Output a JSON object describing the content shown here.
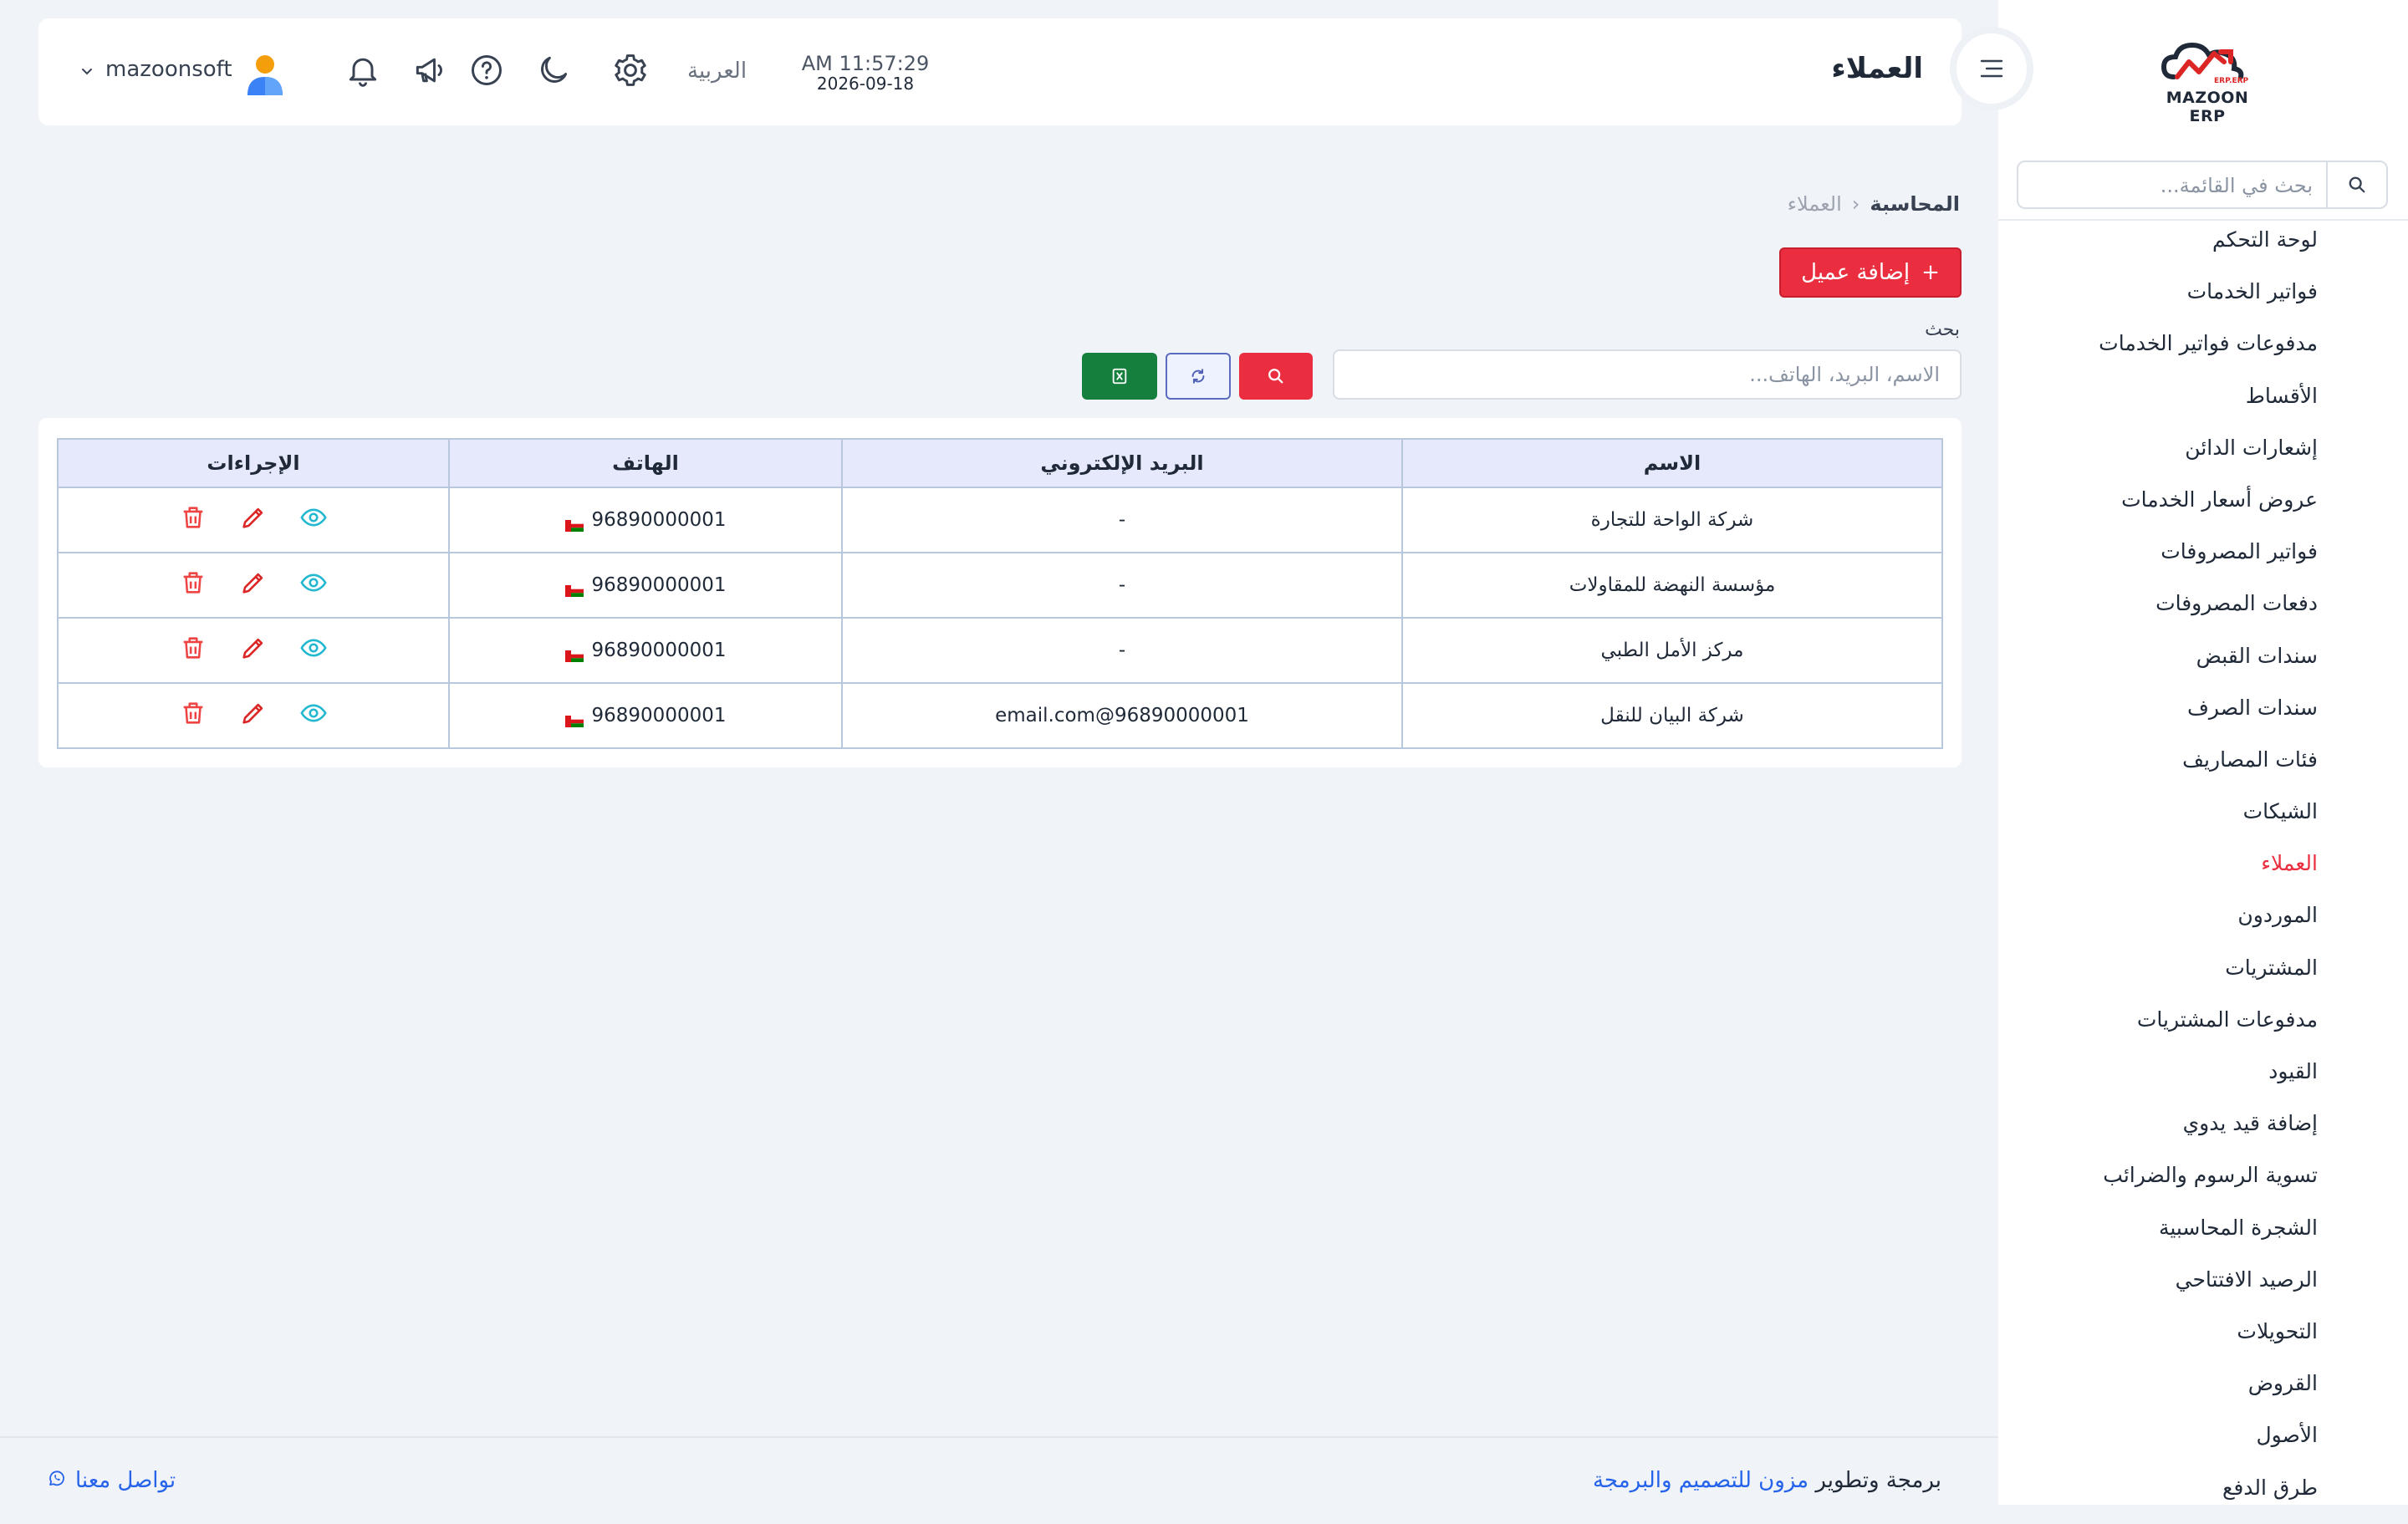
{
  "brand": {
    "logo_text": "MAZOON ERP",
    "logo_sub": "ERP.ERP"
  },
  "sidebar": {
    "search_placeholder": "بحث في القائمة...",
    "items": [
      {
        "label": "لوحة التحكم"
      },
      {
        "label": "فواتير الخدمات"
      },
      {
        "label": "مدفوعات فواتير الخدمات"
      },
      {
        "label": "الأقساط"
      },
      {
        "label": "إشعارات الدائن"
      },
      {
        "label": "عروض أسعار الخدمات"
      },
      {
        "label": "فواتير المصروفات"
      },
      {
        "label": "دفعات المصروفات"
      },
      {
        "label": "سندات القبض"
      },
      {
        "label": "سندات الصرف"
      },
      {
        "label": "فئات المصاريف"
      },
      {
        "label": "الشيكات"
      },
      {
        "label": "العملاء",
        "active": true
      },
      {
        "label": "الموردون"
      },
      {
        "label": "المشتريات"
      },
      {
        "label": "مدفوعات المشتريات"
      },
      {
        "label": "القيود"
      },
      {
        "label": "إضافة قيد يدوي"
      },
      {
        "label": "تسوية الرسوم والضرائب"
      },
      {
        "label": "الشجرة المحاسبية"
      },
      {
        "label": "الرصيد الافتتاحي"
      },
      {
        "label": "التحويلات"
      },
      {
        "label": "القروض"
      },
      {
        "label": "الأصول"
      },
      {
        "label": "طرق الدفع"
      }
    ]
  },
  "header": {
    "title": "العملاء",
    "time": "AM 11:57:29",
    "date": "2026-09-18",
    "language": "العربية",
    "username": "mazoonsoft"
  },
  "breadcrumb": {
    "parent": "المحاسبة",
    "current": "العملاء"
  },
  "actions": {
    "add_customer": "إضافة عميل"
  },
  "search": {
    "label": "بحث",
    "placeholder": "الاسم، البريد، الهاتف..."
  },
  "table": {
    "columns": [
      "الاسم",
      "البريد الإلكتروني",
      "الهاتف",
      "الإجراءات"
    ],
    "rows": [
      {
        "name": "شركة الواحة للتجارة",
        "email": "-",
        "phone": "96890000001"
      },
      {
        "name": "مؤسسة النهضة للمقاولات",
        "email": "-",
        "phone": "96890000001"
      },
      {
        "name": "مركز الأمل الطبي",
        "email": "-",
        "phone": "96890000001"
      },
      {
        "name": "شركة البيان للنقل",
        "email": "email.com@96890000001",
        "phone": "96890000001"
      }
    ]
  },
  "footer": {
    "credit_prefix": "برمجة وتطوير",
    "credit_link": "مزون للتصميم والبرمجة",
    "contact": "تواصل معنا"
  },
  "colors": {
    "accent": "#ea2e3f",
    "excel": "#15803d",
    "view_icon": "#22b8cf",
    "edit_icon": "#dc2626",
    "delete_icon": "#ef4444",
    "link": "#2563eb"
  },
  "icons": [
    "hamburger-icon",
    "search-icon",
    "settings-icon",
    "moon-icon",
    "help-icon",
    "megaphone-icon",
    "bell-icon",
    "chevron-down-icon",
    "refresh-icon",
    "excel-icon",
    "eye-icon",
    "pencil-icon",
    "trash-icon",
    "whatsapp-icon",
    "oman-flag-icon"
  ]
}
